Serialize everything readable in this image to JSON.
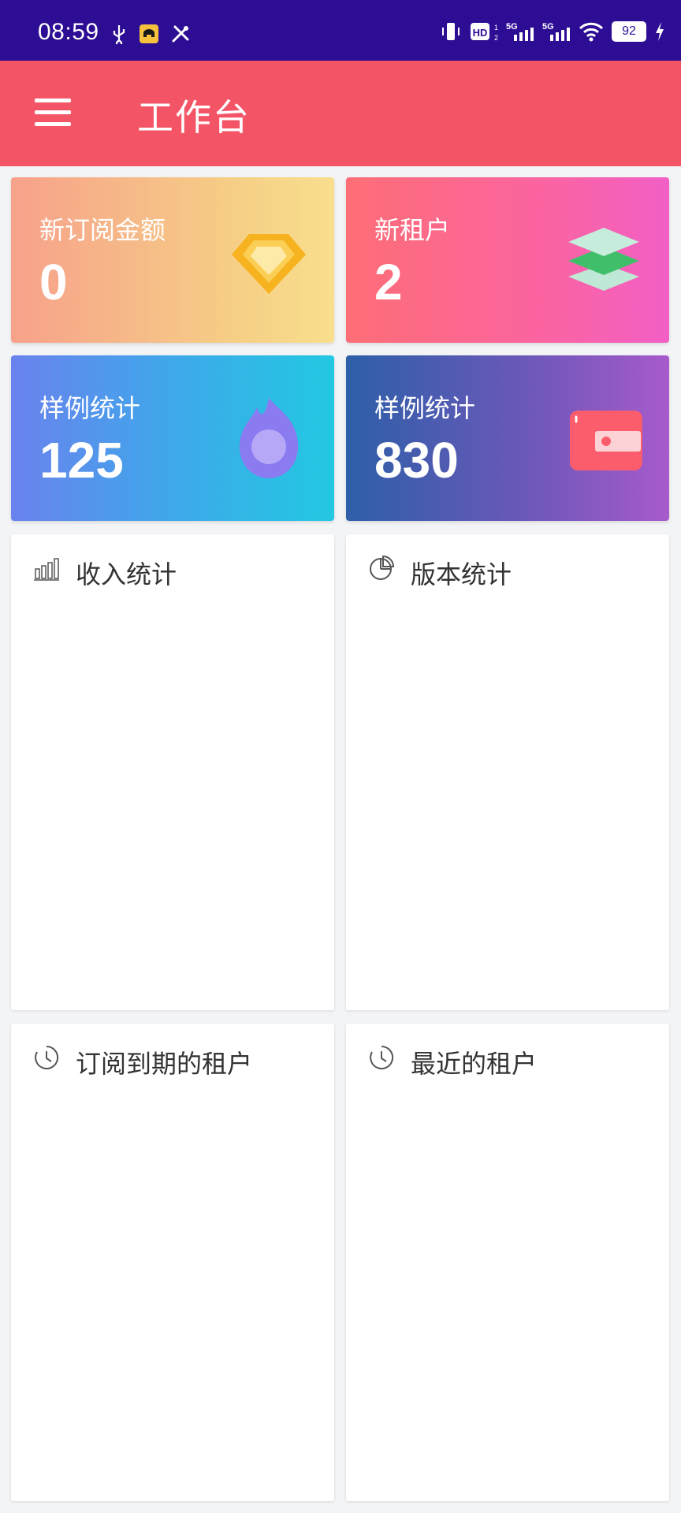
{
  "status_bar": {
    "time": "08:59",
    "left_icons": [
      "usb-icon",
      "car-app-icon",
      "tools-icon"
    ],
    "right_icons": [
      "vibrate-icon",
      "hd-icon",
      "signal-5g-icon",
      "signal-5g-icon",
      "wifi-icon",
      "battery-icon",
      "charging-icon"
    ],
    "battery": "92"
  },
  "app_bar": {
    "title": "工作台",
    "color": "#f35566"
  },
  "stats": [
    {
      "label": "新订阅金额",
      "value": "0",
      "icon": "diamond-icon"
    },
    {
      "label": "新租户",
      "value": "2",
      "icon": "layers-icon"
    },
    {
      "label": "样例统计",
      "value": "125",
      "icon": "fire-icon"
    },
    {
      "label": "样例统计",
      "value": "830",
      "icon": "wallet-icon"
    }
  ],
  "panels": [
    {
      "title": "收入统计",
      "icon": "bar-chart-icon"
    },
    {
      "title": "版本统计",
      "icon": "pie-chart-icon"
    },
    {
      "title": "订阅到期的租户",
      "icon": "clock-icon"
    },
    {
      "title": "最近的租户",
      "icon": "clock-icon"
    }
  ]
}
